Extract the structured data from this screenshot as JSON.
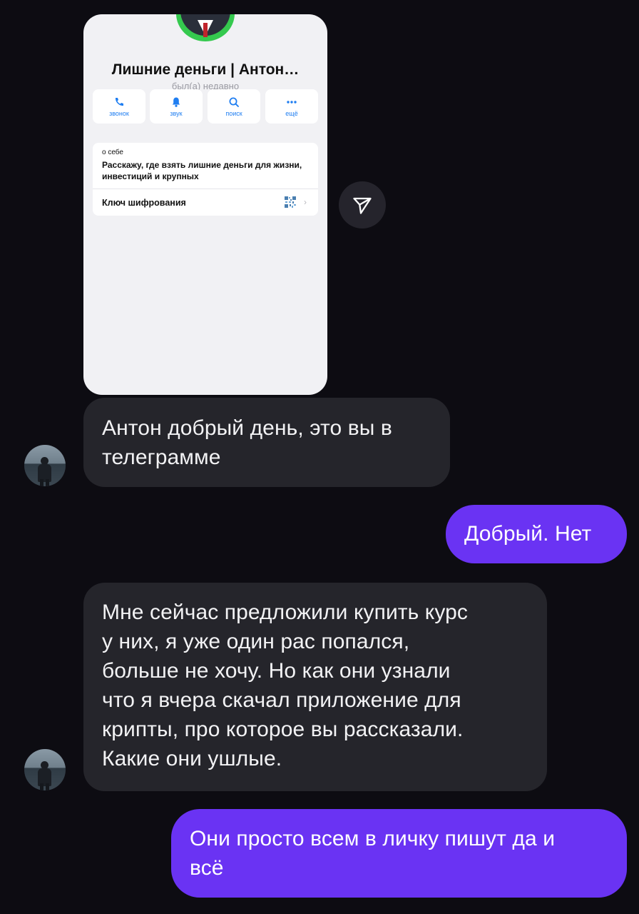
{
  "shared_profile": {
    "name": "Лишние деньги | Антон…",
    "status": "был(а) недавно",
    "actions": [
      {
        "label": "звонок",
        "icon": "phone-icon"
      },
      {
        "label": "звук",
        "icon": "bell-icon"
      },
      {
        "label": "поиск",
        "icon": "search-icon"
      },
      {
        "label": "ещё",
        "icon": "more-icon"
      }
    ],
    "about_label": "о себе",
    "about_text": "Расскажу, где взять лишние деньги для жизни, инвестиций и крупных",
    "encryption_key_label": "Ключ шифрования",
    "chevron": "›"
  },
  "messages": [
    {
      "direction": "incoming",
      "text": "Антон добрый день, это вы в\nтелеграмме"
    },
    {
      "direction": "outgoing",
      "text": "Добрый. Нет"
    },
    {
      "direction": "incoming",
      "text": "Мне сейчас предложили купить курс\nу них, я уже один рас попался,\nбольше не хочу. Но как они узнали\nчто я вчера скачал приложение для\nкрипты, про которое вы рассказали.\nКакие они ушлые."
    },
    {
      "direction": "outgoing",
      "text": "Они просто всем в личку пишут да и\nвсё"
    }
  ],
  "colors": {
    "background": "#0d0c12",
    "incoming_bubble": "#25252b",
    "outgoing_bubble": "#6a33f3",
    "accent_blue": "#1f7ef1"
  }
}
